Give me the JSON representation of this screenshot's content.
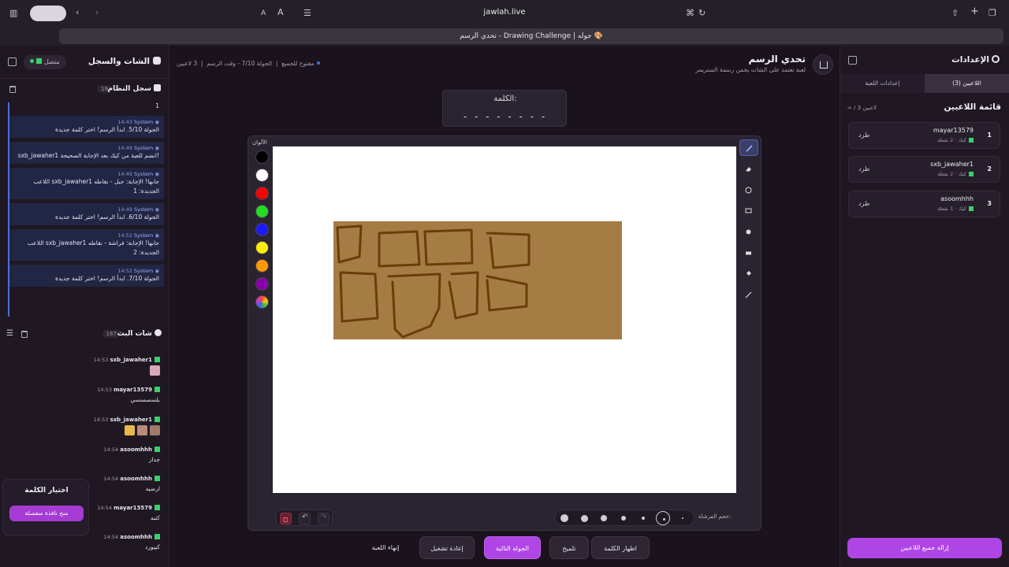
{
  "browser": {
    "url": "jawlah.live",
    "tab_title": "تحدي الرسم - Drawing Challenge | جوله 🎨"
  },
  "left_panel": {
    "title": "الشات والسجل",
    "status": "متصل",
    "system_log": {
      "title": "سجل النظام",
      "count": "19",
      "top_fragment": "1",
      "messages": [
        {
          "sender": "System",
          "time": "14:43",
          "text": "الجولة 5/10. ابدأ الرسم! اختر كلمة جديدة"
        },
        {
          "sender": "System",
          "time": "14:49",
          "text": "sxb_jawaher1 انضم للعبة من كيك بعد الإجابة الصحيحة!"
        },
        {
          "sender": "System",
          "time": "14:49",
          "text": "اللاعب sxb_jawaher1 جابها! الإجابة: جبل - نقاطه الجديدة: 1"
        },
        {
          "sender": "System",
          "time": "14:49",
          "text": "الجولة 6/10. ابدأ الرسم! اختر كلمة جديدة"
        },
        {
          "sender": "System",
          "time": "14:52",
          "text": "اللاعب sxb_jawaher1 جابها! الإجابة: فراشة - نقاطه الجديدة: 2"
        },
        {
          "sender": "System",
          "time": "14:52",
          "text": "الجولة 7/10. ابدأ الرسم! اختر كلمة جديدة"
        }
      ]
    },
    "chat": {
      "title": "شات البث",
      "count": "167",
      "messages": [
        {
          "user": "sxb_jawaher1",
          "time": "14:53",
          "text": ""
        },
        {
          "user": "mayar13579",
          "time": "14:53",
          "text": "بلسسسسي"
        },
        {
          "user": "sxb_jawaher1",
          "time": "14:53",
          "text": ""
        },
        {
          "user": "asoomhhh",
          "time": "14:54",
          "text": "جدار"
        },
        {
          "user": "asoomhhh",
          "time": "14:54",
          "text": "ارضيه"
        },
        {
          "user": "mayar13579",
          "time": "14:54",
          "text": "كتبه"
        },
        {
          "user": "asoomhhh",
          "time": "14:54",
          "text": "كيبورد"
        }
      ]
    },
    "choose_word": {
      "title": "اختيار الكلمة",
      "button": "منح نافذة منفصلة"
    }
  },
  "center": {
    "title": "تحدي الرسم",
    "subtitle": "لعبة تعتمد على الشات يخمن رسمة الستريمر",
    "round_info": {
      "open": "مفتوح للجميع",
      "round": "الجولة 7/10 - وقت الرسم",
      "players": "3 لاعبين"
    },
    "word_box": {
      "label": "الكلمة:",
      "dashes": "- - - - - - - -"
    },
    "colors_label": "الألوان",
    "colors": [
      "#000000",
      "#ffffff",
      "#ff0000",
      "#22dd22",
      "#1a1aff",
      "#ffee00",
      "#ff9900",
      "#8a00a8"
    ],
    "brush_label": "حجم الفرشاة:",
    "drawing": {
      "fill_color": "#a67c45",
      "stroke_color": "#6b3d0a"
    },
    "actions": {
      "reveal_word": "اظهار الكلمة",
      "hint": "تلميح",
      "next_round": "الجولة التالية",
      "restart": "إعادة تشغيل",
      "end_game": "إنهاء اللعبة"
    }
  },
  "right_panel": {
    "title": "الإعدادات",
    "tabs": [
      "اللاعبين (3)",
      "إعدادات اللعبة"
    ],
    "players_title": "قائمة اللاعبين",
    "players_count": "∞ / 3 لاعبين",
    "kick_label": "طرد",
    "players": [
      {
        "rank": "1",
        "name": "mayar13579",
        "score": "كيك · 2 نقطة"
      },
      {
        "rank": "2",
        "name": "sxb_jawaher1",
        "score": "كيك · 2 نقطة"
      },
      {
        "rank": "3",
        "name": "asoomhhh",
        "score": "كيك · 1 نقطة"
      }
    ],
    "remove_all": "إزالة جميع اللاعبين"
  }
}
